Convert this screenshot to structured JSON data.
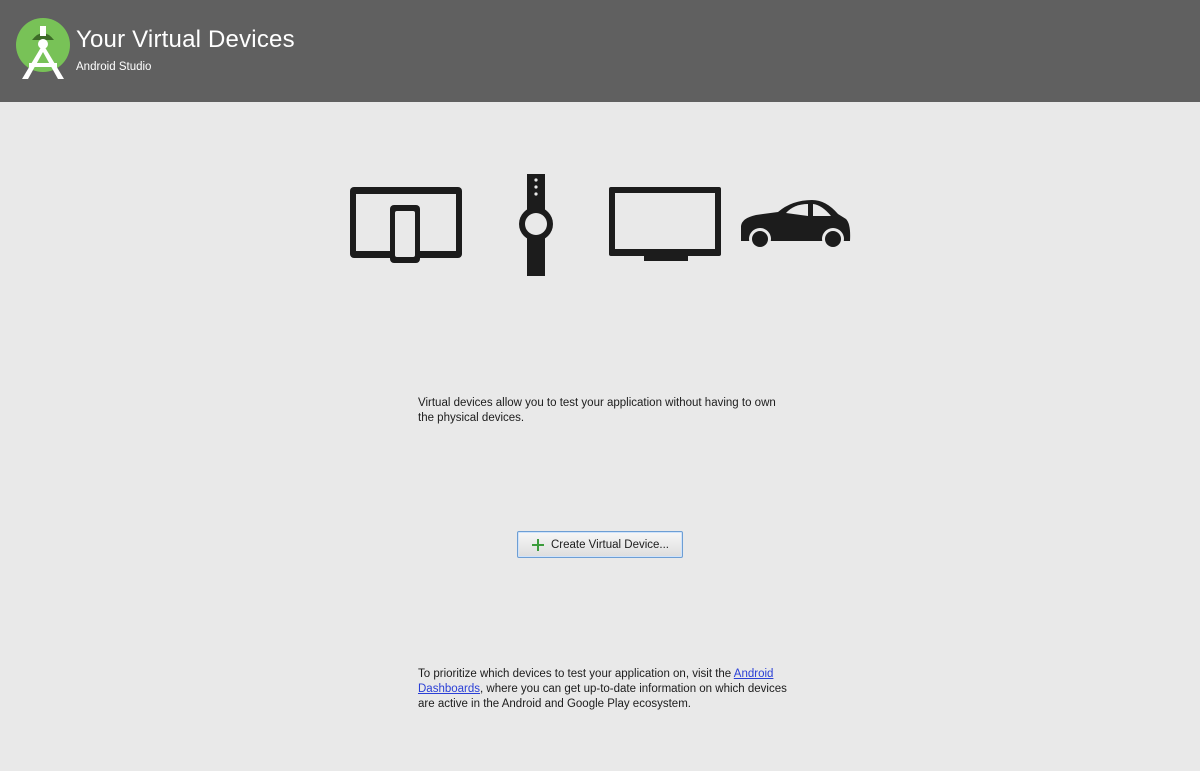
{
  "header": {
    "title": "Your Virtual Devices",
    "subtitle": "Android Studio",
    "background": "#606060",
    "logo_icon": "android-studio-logo-icon"
  },
  "device_icons": [
    "tablet-phone-icon",
    "watch-icon",
    "tv-icon",
    "car-icon"
  ],
  "intro": {
    "text": "Virtual devices allow you to test your application without having to own the physical devices."
  },
  "create_button": {
    "label": "Create Virtual Device...",
    "icon": "plus-icon",
    "icon_color": "#3c9c3c"
  },
  "footer": {
    "text_before": "To prioritize which devices to test your application on, visit the ",
    "link_text": "Android Dashboards",
    "text_after": ", where you can get up-to-date information on which devices are active in the Android and Google Play ecosystem.",
    "link_color": "#2a3fd6"
  }
}
